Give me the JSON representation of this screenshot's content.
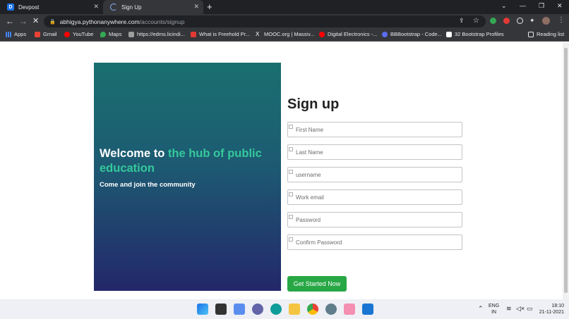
{
  "tabs": [
    {
      "icon_letter": "D",
      "title": "Devpost"
    },
    {
      "title": "Sign Up"
    }
  ],
  "toolbar": {
    "url_host": "abhigya.pythonanywhere.com",
    "url_path": "/accounts/signup"
  },
  "bookmarks": [
    {
      "label": "Apps",
      "color": "#4285f4"
    },
    {
      "label": "Gmail",
      "color": "#ea4335"
    },
    {
      "label": "YouTube",
      "color": "#ff0000"
    },
    {
      "label": "Maps",
      "color": "#34a853"
    },
    {
      "label": "https://edms.licindi...",
      "color": "#5f6368"
    },
    {
      "label": "What is Freehold Pr...",
      "color": "#e53935"
    },
    {
      "label": "MOOC.org | Massiv...",
      "color": "#ffffff"
    },
    {
      "label": "Digital Electronics -...",
      "color": "#ff0000"
    },
    {
      "label": "BBBootstrap - Code...",
      "color": "#5b6cf0"
    },
    {
      "label": "32 Bootstrap Profiles",
      "color": "#ffffff"
    }
  ],
  "reading_list": "Reading list",
  "hero": {
    "heading_plain": "Welcome to ",
    "heading_accent": "the hub of public education",
    "subheading": "Come and join the community"
  },
  "form": {
    "title": "Sign up",
    "fields": [
      {
        "placeholder": "First Name"
      },
      {
        "placeholder": "Last Name"
      },
      {
        "placeholder": "username"
      },
      {
        "placeholder": "Work email"
      },
      {
        "placeholder": "Password"
      },
      {
        "placeholder": "Confirm Password"
      }
    ],
    "submit_label": "Get Started Now"
  },
  "taskbar": {
    "lang_top": "ENG",
    "lang_bottom": "IN",
    "time": "18:10",
    "date": "21-11-2021"
  },
  "colors": {
    "accent_green": "#35c89b",
    "button_green": "#28a745"
  }
}
